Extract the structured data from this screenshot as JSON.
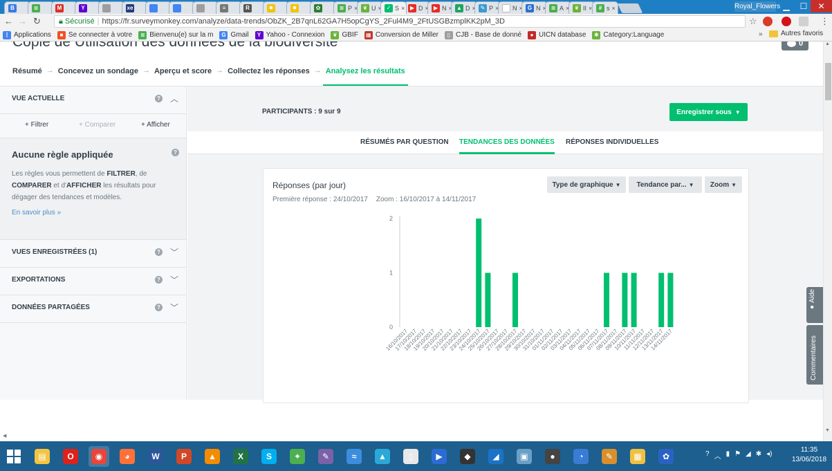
{
  "browser": {
    "tabs": [
      {
        "icon": "grid-icon",
        "label": "",
        "color": "#3b78e7",
        "glyph": "B"
      },
      {
        "icon": "gbif-icon",
        "label": "",
        "color": "#4caf50",
        "glyph": "≋"
      },
      {
        "icon": "gmail-icon",
        "label": "",
        "color": "#d93025",
        "glyph": "M"
      },
      {
        "icon": "yahoo-icon",
        "label": "",
        "color": "#6001d2",
        "glyph": "Y"
      },
      {
        "icon": "doc-icon",
        "label": "",
        "color": "#9e9e9e",
        "glyph": ""
      },
      {
        "icon": "xe-icon",
        "label": "",
        "color": "#243b7a",
        "glyph": "xe"
      },
      {
        "icon": "translate-icon",
        "label": "",
        "color": "#4285f4",
        "glyph": ""
      },
      {
        "icon": "translate-icon",
        "label": "",
        "color": "#4285f4",
        "glyph": ""
      },
      {
        "icon": "doc-icon",
        "label": "",
        "color": "#9e9e9e",
        "glyph": ""
      },
      {
        "icon": "menu-icon",
        "label": "",
        "color": "#777777",
        "glyph": "≡"
      },
      {
        "icon": "r-icon",
        "label": "",
        "color": "#555555",
        "glyph": "R"
      },
      {
        "icon": "star-icon",
        "label": "",
        "color": "#f4c20d",
        "glyph": "✸"
      },
      {
        "icon": "star-icon",
        "label": "",
        "color": "#f4c20d",
        "glyph": "✸"
      },
      {
        "icon": "leaf-icon",
        "label": "",
        "color": "#2e7d32",
        "glyph": "✿"
      },
      {
        "icon": "gbif-icon",
        "label": "P",
        "color": "#4caf50",
        "glyph": "≋"
      },
      {
        "icon": "leaf-icon",
        "label": "U",
        "color": "#6bb33a",
        "glyph": "❦"
      },
      {
        "icon": "surveymonkey-icon",
        "label": "S",
        "color": "#00bf6f",
        "glyph": "✓",
        "active": true
      },
      {
        "icon": "youtube-icon",
        "label": "D",
        "color": "#e52d27",
        "glyph": "▶"
      },
      {
        "icon": "youtube-icon",
        "label": "N",
        "color": "#e52d27",
        "glyph": "▶"
      },
      {
        "icon": "drive-icon",
        "label": "D",
        "color": "#1fa463",
        "glyph": "▲"
      },
      {
        "icon": "pen-icon",
        "label": "P",
        "color": "#3d9ad1",
        "glyph": "✎"
      },
      {
        "icon": "blank-icon",
        "label": "N",
        "color": "#ffffff",
        "glyph": ""
      },
      {
        "icon": "g-icon",
        "label": "N",
        "color": "#2c6fcf",
        "glyph": "G"
      },
      {
        "icon": "gbif-icon",
        "label": "A",
        "color": "#4caf50",
        "glyph": "≋"
      },
      {
        "icon": "leaf-icon",
        "label": "II",
        "color": "#6bb33a",
        "glyph": "❦"
      },
      {
        "icon": "hash-icon",
        "label": "s",
        "color": "#4caf50",
        "glyph": "#"
      }
    ],
    "window_user": "Royal_Flowers",
    "address": {
      "secure_label": "Sécurisé",
      "url": "https://fr.surveymonkey.com/analyze/data-trends/ObZK_2B7qnL62GA7H5opCgYS_2Ful4M9_2FtUSGBzmplKK2pM_3D"
    },
    "bookmarks": [
      {
        "icon": "apps-icon",
        "label": "Applications",
        "color": "#4285f4",
        "glyph": "⋮"
      },
      {
        "icon": "windows-icon",
        "label": "Se connecter à votre",
        "color": "#f25022",
        "glyph": "■"
      },
      {
        "icon": "gbif-icon",
        "label": "Bienvenu(e) sur la m",
        "color": "#4caf50",
        "glyph": "≋"
      },
      {
        "icon": "google-icon",
        "label": "Gmail",
        "color": "#4285f4",
        "glyph": "G"
      },
      {
        "icon": "yahoo-icon",
        "label": "Yahoo - Connexion",
        "color": "#6001d2",
        "glyph": "Y"
      },
      {
        "icon": "leaf-icon",
        "label": "GBIF",
        "color": "#6bb33a",
        "glyph": "❦"
      },
      {
        "icon": "convert-icon",
        "label": "Conversion de Miller",
        "color": "#c0392b",
        "glyph": "▦"
      },
      {
        "icon": "doc-icon",
        "label": "CJB - Base de donné",
        "color": "#9e9e9e",
        "glyph": "▯"
      },
      {
        "icon": "iucn-icon",
        "label": "UICN database",
        "color": "#c62828",
        "glyph": "●"
      },
      {
        "icon": "leaf-icon",
        "label": "Category:Language",
        "color": "#6bb33a",
        "glyph": "✱"
      }
    ],
    "bookmarks_other": "Autres favoris"
  },
  "page": {
    "title": "Copie de Utilisation des données de la biodiversité",
    "comment_count": "0",
    "steps": [
      {
        "label": "Résumé"
      },
      {
        "label": "Concevez un sondage"
      },
      {
        "label": "Aperçu et score"
      },
      {
        "label": "Collectez les réponses"
      },
      {
        "label": "Analysez les résultats",
        "active": true
      }
    ]
  },
  "sidebar": {
    "current_view": "VUE ACTUELLE",
    "actions": {
      "filter": "+ Filtrer",
      "compare": "+ Comparer",
      "show": "+ Afficher"
    },
    "rules": {
      "title": "Aucune règle appliquée",
      "text_parts": [
        "Les règles vous permettent de ",
        "FILTRER",
        ", de ",
        "COMPARER",
        " et d'",
        "AFFICHER",
        " les résultats pour dégager des tendances et modèles."
      ],
      "link": "En savoir plus »"
    },
    "sections": [
      "VUES ENREGISTRÉES (1)",
      "EXPORTATIONS",
      "DONNÉES PARTAGÉES"
    ]
  },
  "main": {
    "participants": "PARTICIPANTS : 9 sur 9",
    "save_button": "Enregistrer sous",
    "view_tabs": {
      "summary": "RÉSUMÉS PAR QUESTION",
      "trends": "TENDANCES DES DONNÉES",
      "individual": "RÉPONSES INDIVIDUELLES"
    },
    "card": {
      "title": "Réponses (par jour)",
      "first_response": "Première réponse : 24/10/2017",
      "zoom": "Zoom : 16/10/2017 à 14/11/2017",
      "controls": {
        "type": "Type de graphique",
        "trend": "Tendance par...",
        "zoom": "Zoom"
      }
    }
  },
  "widgets": {
    "help": "Aide",
    "comments": "Commentaires"
  },
  "chart_data": {
    "type": "bar",
    "title": "Réponses (par jour)",
    "xlabel": "",
    "ylabel": "",
    "ylim": [
      0,
      2
    ],
    "y_ticks": [
      0,
      1,
      2
    ],
    "grid": false,
    "color": "#00bf6f",
    "categories": [
      "16/10/2017",
      "17/10/2017",
      "18/10/2017",
      "19/10/2017",
      "20/10/2017",
      "21/10/2017",
      "22/10/2017",
      "23/10/2017",
      "24/10/2017",
      "25/10/2017",
      "26/10/2017",
      "27/10/2017",
      "28/10/2017",
      "29/10/2017",
      "30/10/2017",
      "31/10/2017",
      "01/11/2017",
      "02/11/2017",
      "03/11/2017",
      "04/11/2017",
      "05/11/2017",
      "06/11/2017",
      "07/11/2017",
      "08/11/2017",
      "09/11/2017",
      "10/11/2017",
      "11/11/2017",
      "12/11/2017",
      "13/11/2017",
      "14/11/2017"
    ],
    "values": [
      0,
      0,
      0,
      0,
      0,
      0,
      0,
      0,
      2,
      1,
      0,
      0,
      1,
      0,
      0,
      0,
      0,
      0,
      0,
      0,
      0,
      0,
      1,
      0,
      1,
      1,
      0,
      0,
      1,
      1
    ]
  },
  "taskbar": {
    "apps": [
      {
        "icon": "file-explorer-icon",
        "color": "#f4c542",
        "glyph": "▤"
      },
      {
        "icon": "opera-icon",
        "color": "#e0201b",
        "glyph": "O"
      },
      {
        "icon": "chrome-icon",
        "color": "#e8453c",
        "glyph": "◉",
        "active": true
      },
      {
        "icon": "firefox-icon",
        "color": "#ff7139",
        "glyph": "◕"
      },
      {
        "icon": "word-icon",
        "color": "#2b579a",
        "glyph": "W"
      },
      {
        "icon": "powerpoint-icon",
        "color": "#d24726",
        "glyph": "P"
      },
      {
        "icon": "vlc-icon",
        "color": "#f48b00",
        "glyph": "▲"
      },
      {
        "icon": "excel-icon",
        "color": "#217346",
        "glyph": "X"
      },
      {
        "icon": "skype-icon",
        "color": "#00aff0",
        "glyph": "S"
      },
      {
        "icon": "app-icon",
        "color": "#4caf50",
        "glyph": "✦"
      },
      {
        "icon": "app-icon",
        "color": "#7b61a8",
        "glyph": "✎"
      },
      {
        "icon": "app-icon",
        "color": "#3c8dde",
        "glyph": "≈"
      },
      {
        "icon": "app-icon",
        "color": "#2aa8d8",
        "glyph": "▲"
      },
      {
        "icon": "app-icon",
        "color": "#e8e8e8",
        "glyph": "▯"
      },
      {
        "icon": "media-icon",
        "color": "#2b6cd4",
        "glyph": "▶"
      },
      {
        "icon": "app-icon",
        "color": "#333333",
        "glyph": "◆"
      },
      {
        "icon": "app-icon",
        "color": "#1a73c8",
        "glyph": "◢"
      },
      {
        "icon": "app-icon",
        "color": "#6aa0c8",
        "glyph": "▣"
      },
      {
        "icon": "app-icon",
        "color": "#444444",
        "glyph": "●"
      },
      {
        "icon": "app-icon",
        "color": "#3a7bd5",
        "glyph": "◔"
      },
      {
        "icon": "paint-icon",
        "color": "#d98f2b",
        "glyph": "✎"
      },
      {
        "icon": "app-icon",
        "color": "#f0c040",
        "glyph": "▦"
      },
      {
        "icon": "settings-icon",
        "color": "#2a62c4",
        "glyph": "✿"
      }
    ],
    "time": "11:35",
    "date": "13/06/2018"
  }
}
